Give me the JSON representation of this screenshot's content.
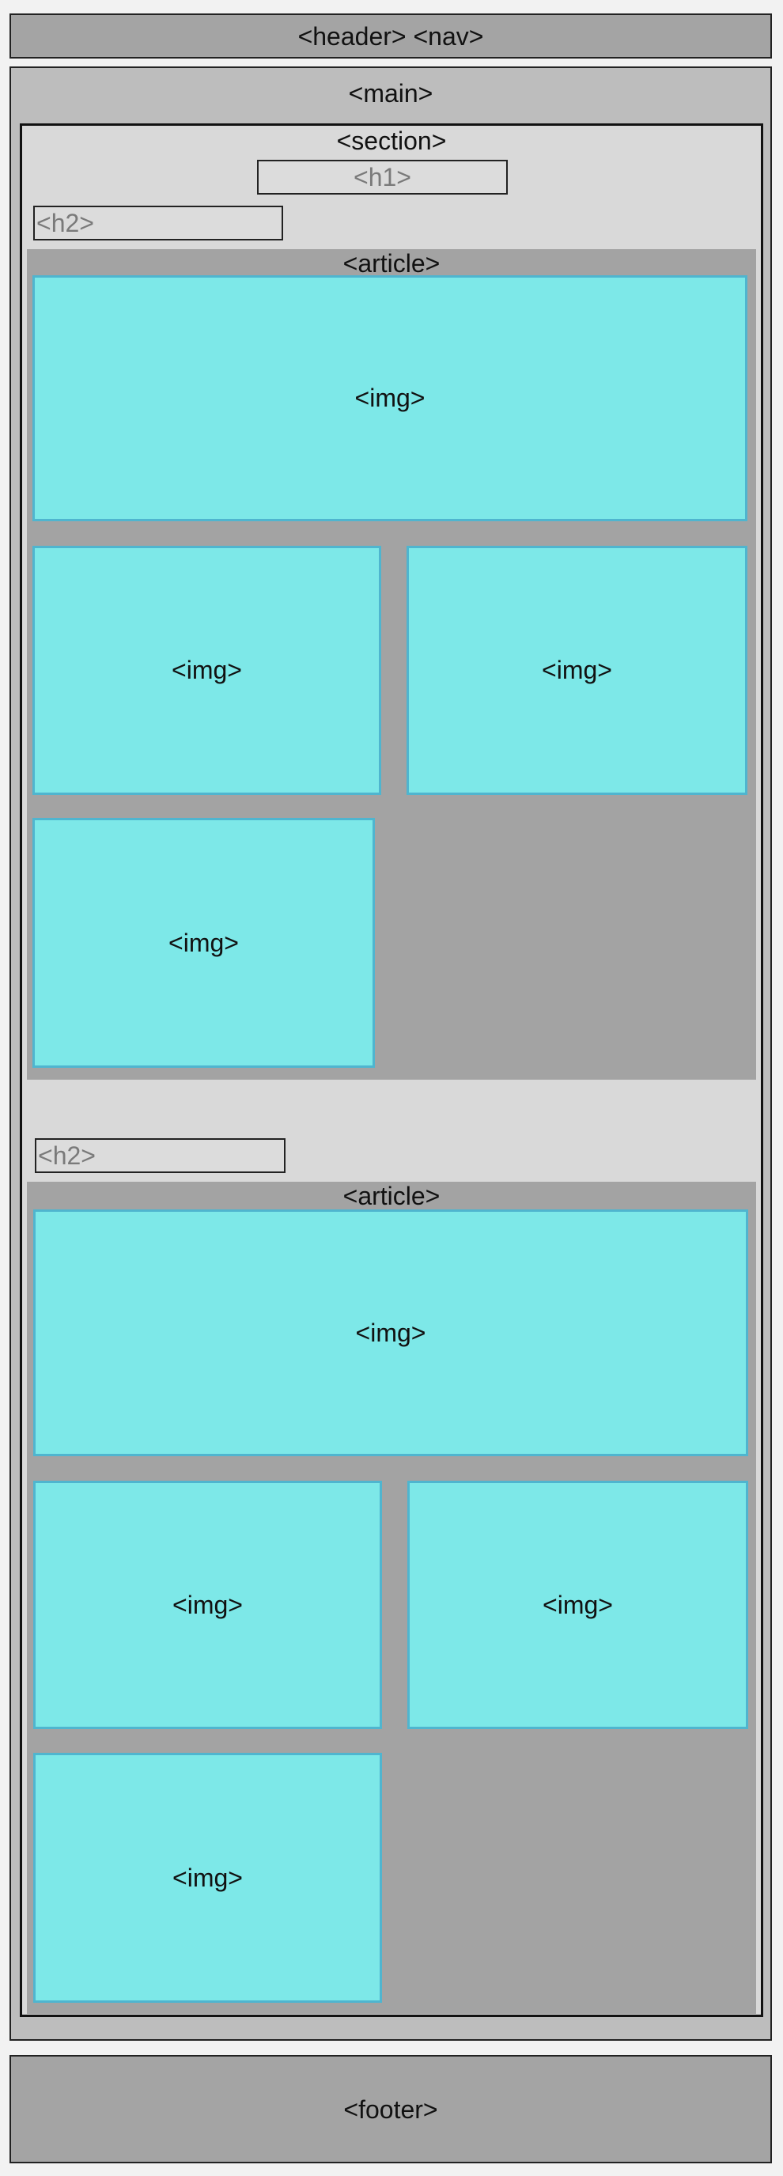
{
  "header": {
    "label": "<header> <nav>"
  },
  "main": {
    "label": "<main>"
  },
  "section": {
    "label": "<section>",
    "h1": "<h1>",
    "blocks": [
      {
        "h2": "<h2>",
        "article": {
          "label": "<article>",
          "images": [
            "<img>",
            "<img>",
            "<img>",
            "<img>"
          ]
        }
      },
      {
        "h2": "<h2>",
        "article": {
          "label": "<article>",
          "images": [
            "<img>",
            "<img>",
            "<img>",
            "<img>"
          ]
        }
      }
    ]
  },
  "footer": {
    "label": "<footer>"
  },
  "colors": {
    "page_background": "#f2f2f2",
    "header_footer": "#a4a4a4",
    "main": "#bdbdbd",
    "section": "#d9d9d9",
    "article": "#a3a3a3",
    "img_fill": "#7de8e8",
    "img_border": "#4fb5cf",
    "placeholder_text": "#7a7a7a"
  }
}
